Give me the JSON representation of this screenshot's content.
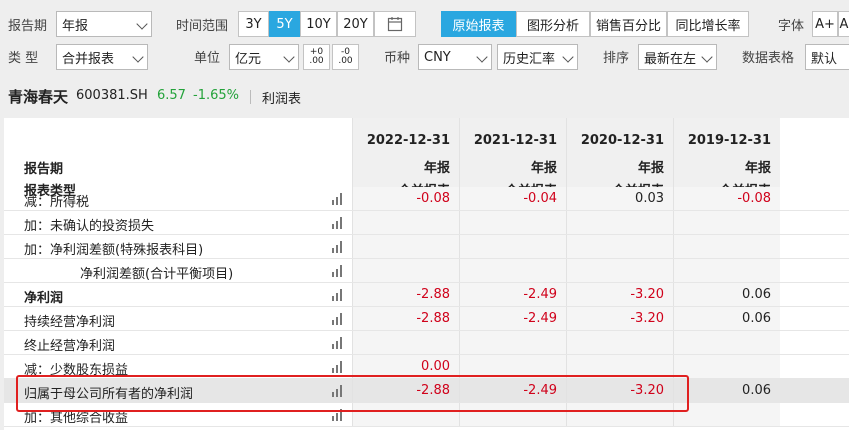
{
  "toolbar1": {
    "period_label": "报告期",
    "period_value": "年报",
    "range_label": "时间范围",
    "range_options": [
      "3Y",
      "5Y",
      "10Y",
      "20Y"
    ],
    "range_active": "5Y",
    "view_tabs": [
      "原始报表",
      "图形分析",
      "销售百分比",
      "同比增长率"
    ],
    "view_active": "原始报表",
    "font_label": "字体",
    "font_plus": "A+",
    "font_minus": "A"
  },
  "toolbar2": {
    "type_label": "类 型",
    "type_value": "合并报表",
    "unit_label": "单位",
    "unit_value": "亿元",
    "decimal_plus_top": "+0",
    "decimal_plus_bottom": ".00",
    "decimal_minus_top": "-0",
    "decimal_minus_bottom": ".00",
    "currency_label": "币种",
    "currency_value": "CNY",
    "rate_value": "历史汇率",
    "sort_label": "排序",
    "sort_value": "最新在左",
    "format_label": "数据表格",
    "format_value": "默认"
  },
  "stock": {
    "name": "青海春天",
    "code": "600381.SH",
    "price": "6.57",
    "change": "-1.65%",
    "statement": "利润表"
  },
  "table": {
    "header_labels": [
      "报告期",
      "报表类型"
    ],
    "columns": [
      {
        "date": "2022-12-31",
        "period": "年报",
        "type": "合并报表"
      },
      {
        "date": "2021-12-31",
        "period": "年报",
        "type": "合并报表"
      },
      {
        "date": "2020-12-31",
        "period": "年报",
        "type": "合并报表"
      },
      {
        "date": "2019-12-31",
        "period": "年报",
        "type": "合并报表"
      }
    ],
    "rows": [
      {
        "name": "减：所得税",
        "values": [
          "-0.08",
          "-0.04",
          "0.03",
          "-0.08"
        ]
      },
      {
        "name": "加：未确认的投资损失",
        "values": [
          "",
          "",
          "",
          ""
        ]
      },
      {
        "name": "加：净利润差额(特殊报表科目)",
        "values": [
          "",
          "",
          "",
          ""
        ]
      },
      {
        "name": "净利润差额(合计平衡项目)",
        "values": [
          "",
          "",
          "",
          ""
        ]
      },
      {
        "name": "净利润",
        "values": [
          "-2.88",
          "-2.49",
          "-3.20",
          "0.06"
        ]
      },
      {
        "name": "持续经营净利润",
        "values": [
          "-2.88",
          "-2.49",
          "-3.20",
          "0.06"
        ]
      },
      {
        "name": "终止经营净利润",
        "values": [
          "",
          "",
          "",
          ""
        ]
      },
      {
        "name": "减：少数股东损益",
        "values": [
          "0.00",
          "",
          "",
          ""
        ]
      },
      {
        "name": "归属于母公司所有者的净利润",
        "values": [
          "-2.88",
          "-2.49",
          "-3.20",
          "0.06"
        ]
      },
      {
        "name": "加：其他综合收益",
        "values": [
          "",
          "",
          "",
          ""
        ]
      }
    ]
  },
  "colors": {
    "accent": "#2aa7e0",
    "negative": "#d0021b",
    "positive_change": "#23a23a",
    "highlight_box": "#e02020"
  }
}
